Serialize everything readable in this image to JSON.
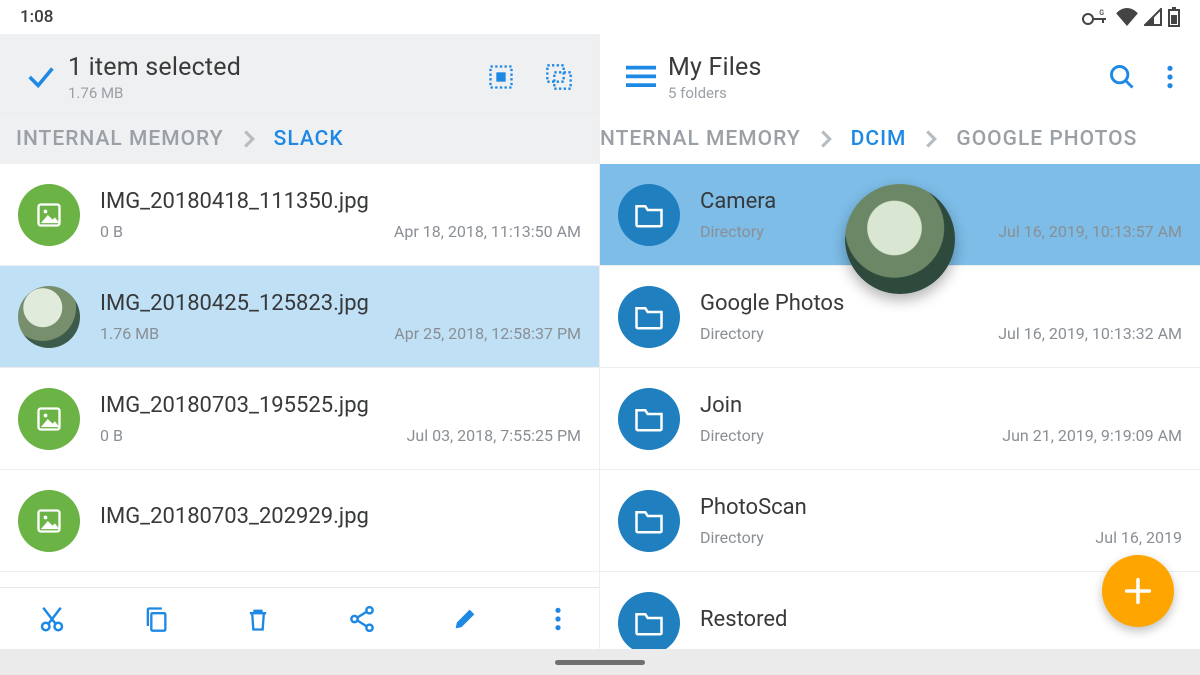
{
  "status": {
    "time": "1:08"
  },
  "left": {
    "header": {
      "title": "1 item selected",
      "subtitle": "1.76 MB"
    },
    "breadcrumb": [
      {
        "label": "INTERNAL MEMORY",
        "active": false
      },
      {
        "label": "SLACK",
        "active": true
      }
    ],
    "files": [
      {
        "name": "IMG_20180418_111350.jpg",
        "size": "0 B",
        "date": "Apr 18, 2018, 11:13:50 AM",
        "icon": "image",
        "selected": false
      },
      {
        "name": "IMG_20180425_125823.jpg",
        "size": "1.76 MB",
        "date": "Apr 25, 2018, 12:58:37 PM",
        "icon": "photo",
        "selected": true
      },
      {
        "name": "IMG_20180703_195525.jpg",
        "size": "0 B",
        "date": "Jul 03, 2018, 7:55:25 PM",
        "icon": "image",
        "selected": false
      },
      {
        "name": "IMG_20180703_202929.jpg",
        "size": "",
        "date": "",
        "icon": "image",
        "selected": false
      }
    ],
    "toolbar": [
      "cut",
      "copy",
      "delete",
      "share",
      "edit",
      "more"
    ]
  },
  "right": {
    "header": {
      "title": "My Files",
      "subtitle": "5 folders"
    },
    "breadcrumb": [
      {
        "label": "NTERNAL MEMORY",
        "active": false
      },
      {
        "label": "DCIM",
        "active": true
      },
      {
        "label": "GOOGLE PHOTOS",
        "active": false
      }
    ],
    "folders": [
      {
        "name": "Camera",
        "type": "Directory",
        "date": "Jul 16, 2019, 10:13:57 AM",
        "highlighted": true
      },
      {
        "name": "Google Photos",
        "type": "Directory",
        "date": "Jul 16, 2019, 10:13:32 AM",
        "highlighted": false
      },
      {
        "name": "Join",
        "type": "Directory",
        "date": "Jun 21, 2019, 9:19:09 AM",
        "highlighted": false
      },
      {
        "name": "PhotoScan",
        "type": "Directory",
        "date": "Jul 16, 2019",
        "highlighted": false
      },
      {
        "name": "Restored",
        "type": "",
        "date": "",
        "highlighted": false
      }
    ]
  },
  "colors": {
    "accent": "#1e88e5",
    "fab": "#ffa500",
    "green": "#6ab344",
    "blue": "#1f7fbf"
  }
}
